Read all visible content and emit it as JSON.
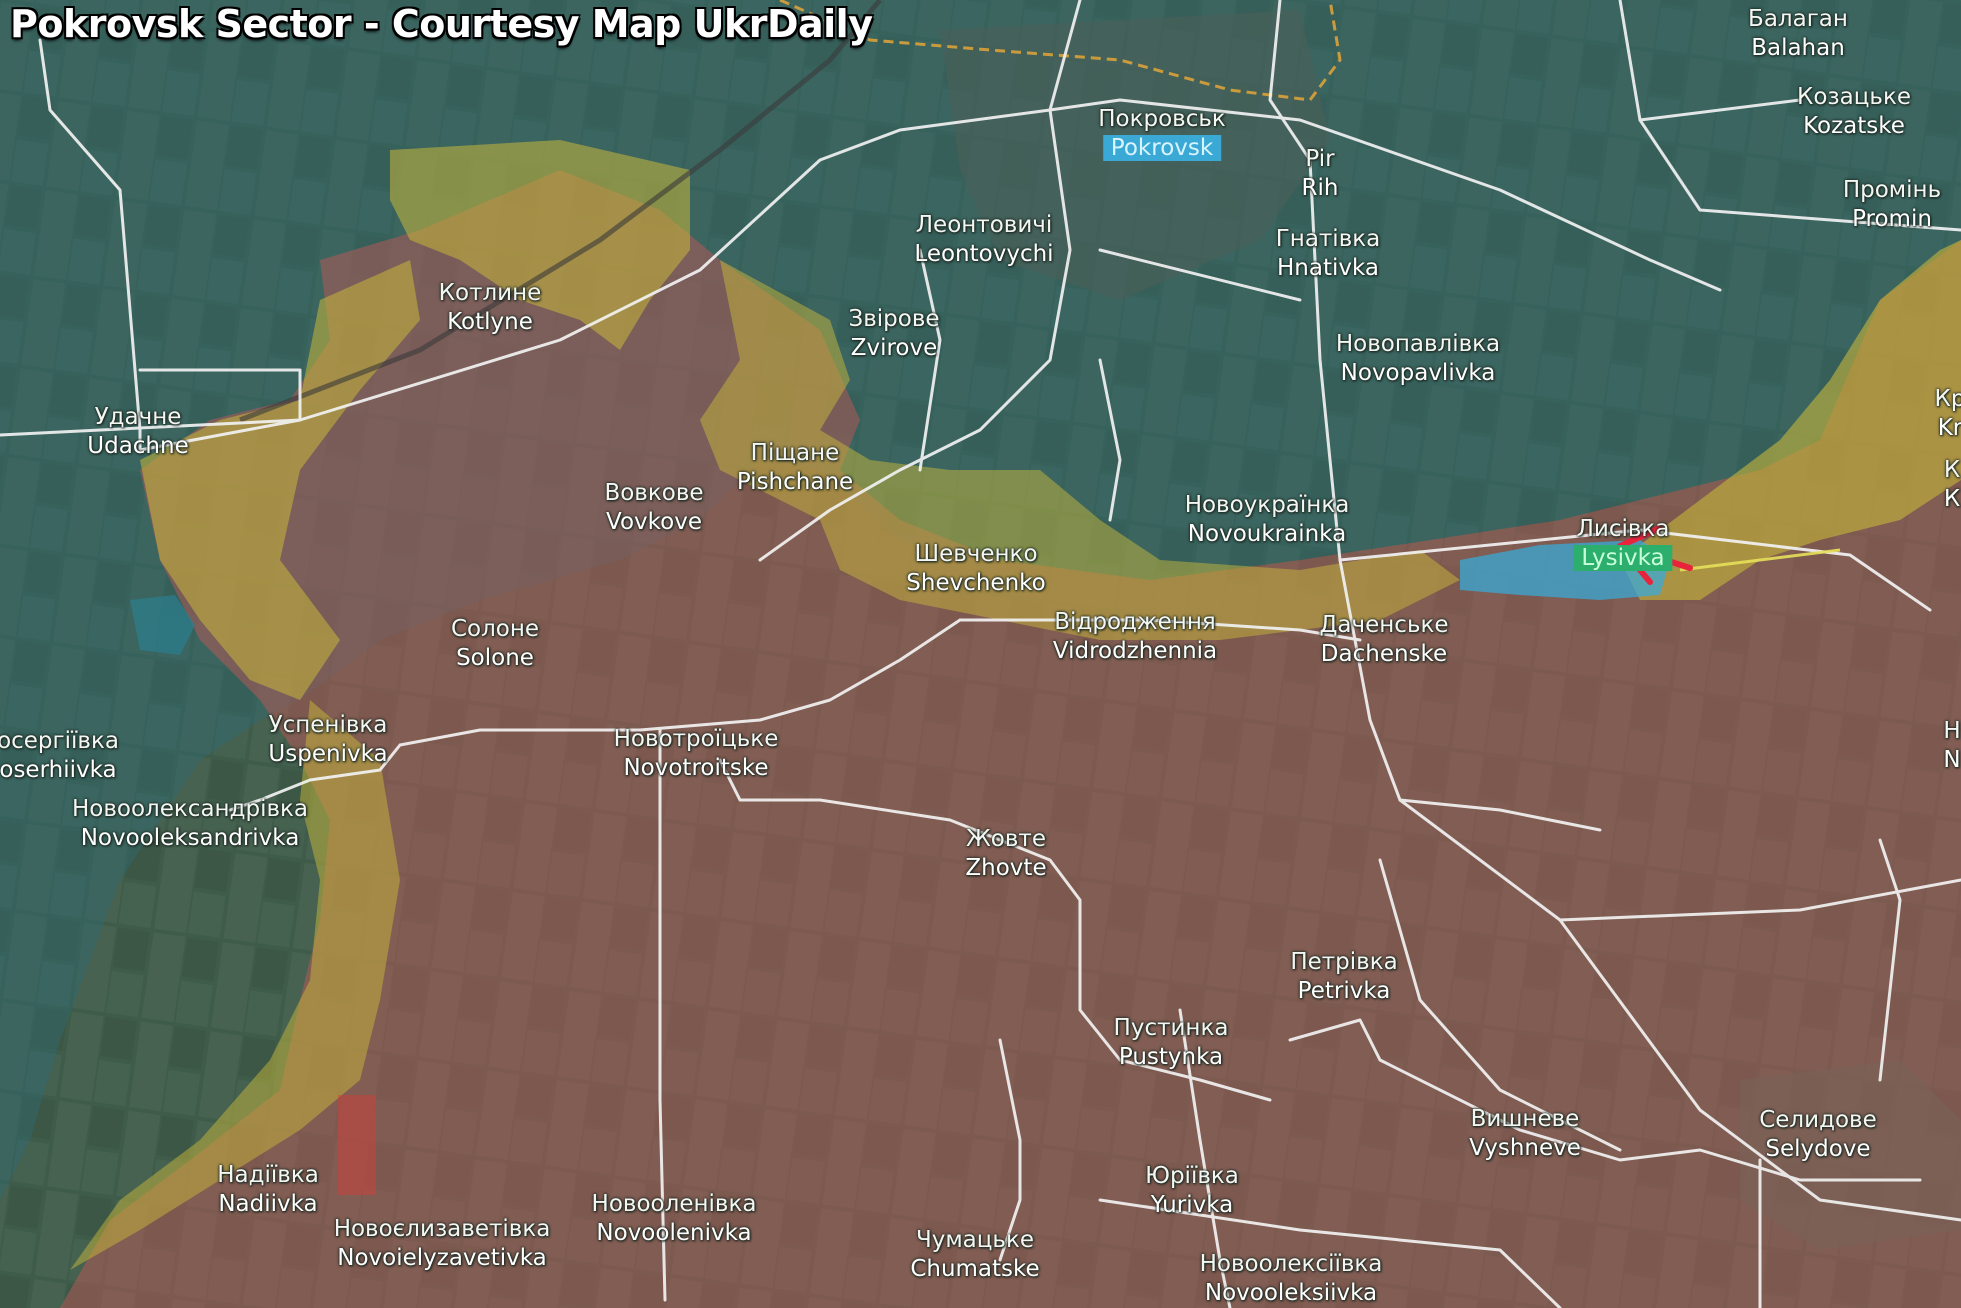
{
  "title": "Pokrovsk Sector - Courtesy Map UkrDaily",
  "colors": {
    "ukrainian_control": "#2f6a74",
    "contested_zone": "#c8b83a",
    "russian_control": "#b05a55",
    "road": "#f2f2f2",
    "railway": "#d9a23a",
    "arrow": "#e8243c"
  },
  "icons": {
    "advance_arrow": "red-arrow-icon"
  },
  "places": [
    {
      "cyr": "Покровськ",
      "lat": "Pokrovsk",
      "highlight": "blue"
    },
    {
      "cyr": "Балаган",
      "lat": "Balahan"
    },
    {
      "cyr": "Козацьке",
      "lat": "Kozatske"
    },
    {
      "cyr": "Промінь",
      "lat": "Promin"
    },
    {
      "cyr": "Pir",
      "lat": "Rih"
    },
    {
      "cyr": "Гнатівка",
      "lat": "Hnativka"
    },
    {
      "cyr": "Леонтовичі",
      "lat": "Leontovychi"
    },
    {
      "cyr": "Звірове",
      "lat": "Zvirove"
    },
    {
      "cyr": "Котлине",
      "lat": "Kotlyne"
    },
    {
      "cyr": "Новопавлівка",
      "lat": "Novopavlivka"
    },
    {
      "cyr": "Удачне",
      "lat": "Udachne"
    },
    {
      "cyr": "Піщане",
      "lat": "Pishchane"
    },
    {
      "cyr": "Вовкове",
      "lat": "Vovkove"
    },
    {
      "cyr": "Новоукраїнка",
      "lat": "Novoukrainka"
    },
    {
      "cyr": "Лисівка",
      "lat": "Lysivka",
      "highlight": "green"
    },
    {
      "cyr": "Шевченко",
      "lat": "Shevchenko"
    },
    {
      "cyr": "Відродження",
      "lat": "Vidrodzhennia"
    },
    {
      "cyr": "Даченське",
      "lat": "Dachenske"
    },
    {
      "cyr": "Солоне",
      "lat": "Solone"
    },
    {
      "cyr": "Успенівка",
      "lat": "Uspenivka"
    },
    {
      "cyr": "осергіївка",
      "lat": "oserhiivka"
    },
    {
      "cyr": "Новотроїцьке",
      "lat": "Novotroitske"
    },
    {
      "cyr": "Новоолександрівка",
      "lat": "Novooleksandrivka"
    },
    {
      "cyr": "Жовте",
      "lat": "Zhovte"
    },
    {
      "cyr": "Петрівка",
      "lat": "Petrivka"
    },
    {
      "cyr": "Пустинка",
      "lat": "Pustynka"
    },
    {
      "cyr": "Вишневе",
      "lat": "Vyshneve"
    },
    {
      "cyr": "Селидове",
      "lat": "Selydove"
    },
    {
      "cyr": "Юріївка",
      "lat": "Yurivka"
    },
    {
      "cyr": "Надіївка",
      "lat": "Nadiivka"
    },
    {
      "cyr": "Новоєлизаветівка",
      "lat": "Novoielyzavetivka"
    },
    {
      "cyr": "Новооленівка",
      "lat": "Novoolenivka"
    },
    {
      "cyr": "Чумацьке",
      "lat": "Chumatske"
    },
    {
      "cyr": "Новоолексіївка",
      "lat": "Novooleksiivka"
    },
    {
      "cyr": "Кр",
      "lat": "Kr"
    },
    {
      "cyr": "К",
      "lat": "К"
    },
    {
      "cyr": "Н",
      "lat": "N"
    }
  ]
}
